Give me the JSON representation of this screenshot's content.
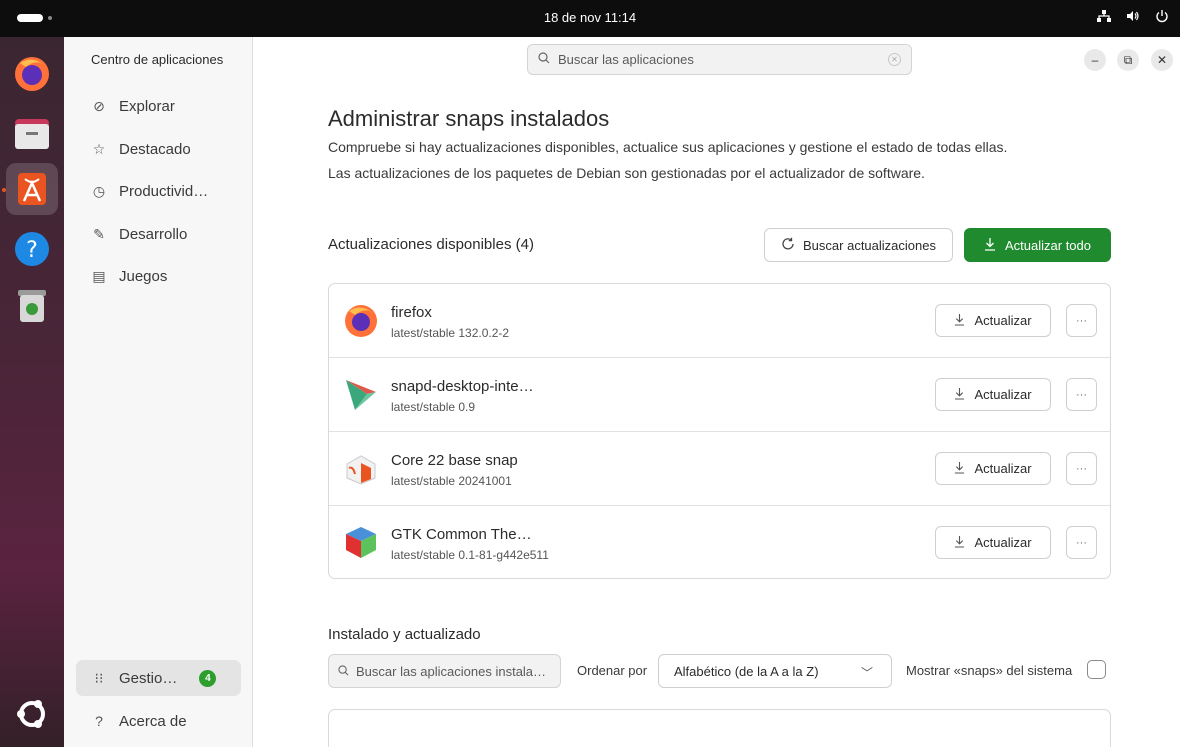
{
  "topbar": {
    "clock": "18 de nov  11:14",
    "tray_icons": [
      "network-icon",
      "volume-icon",
      "power-icon"
    ]
  },
  "dock": {
    "apps": [
      "firefox",
      "files",
      "app-center",
      "help",
      "trash",
      "ubuntu-apps-grid"
    ],
    "active": "app-center"
  },
  "sidebar": {
    "title": "Centro de aplicaciones",
    "items": [
      {
        "label": "Explorar",
        "icon": "compass-icon"
      },
      {
        "label": "Destacado",
        "icon": "star-icon"
      },
      {
        "label": "Productivid…",
        "icon": "clock-icon"
      },
      {
        "label": "Desarrollo",
        "icon": "wrench-icon"
      },
      {
        "label": "Juegos",
        "icon": "gamepad-icon"
      }
    ],
    "manage": {
      "label": "Gestio…",
      "badge": "4",
      "icon": "grid-icon"
    },
    "about": {
      "label": "Acerca de",
      "icon": "help-icon"
    }
  },
  "header": {
    "search_placeholder": "Buscar las aplicaciones"
  },
  "main": {
    "title": "Administrar snaps instalados",
    "desc1": "Compruebe si hay actualizaciones disponibles, actualice sus aplicaciones y gestione el estado de todas ellas.",
    "desc2": "Las actualizaciones de los paquetes de Debian son gestionadas por el actualizador de software.",
    "updates_title": "Actualizaciones disponibles (4)",
    "check_button": "Buscar actualizaciones",
    "update_all_button": "Actualizar todo",
    "update_label": "Actualizar",
    "more_label": "···",
    "updates": [
      {
        "name": "firefox",
        "version": "latest/stable 132.0.2-2",
        "icon": "firefox-icon"
      },
      {
        "name": "snapd-desktop-inte…",
        "version": "latest/stable 0.9",
        "icon": "snapd-icon"
      },
      {
        "name": "Core 22 base snap",
        "version": "latest/stable 20241001",
        "icon": "core22-icon"
      },
      {
        "name": "GTK Common The…",
        "version": "latest/stable 0.1-81-g442e511",
        "icon": "gtk-icon"
      }
    ],
    "installed_title": "Instalado y actualizado",
    "installed_search_placeholder": "Buscar las aplicaciones instala…",
    "sort_label": "Ordenar por",
    "sort_value": "Alfabético (de la A a la Z)",
    "system_snaps_label": "Mostrar «snaps» del sistema"
  },
  "colors": {
    "accent_green": "#1f8a2e",
    "dock_active_indicator": "#e95420"
  }
}
